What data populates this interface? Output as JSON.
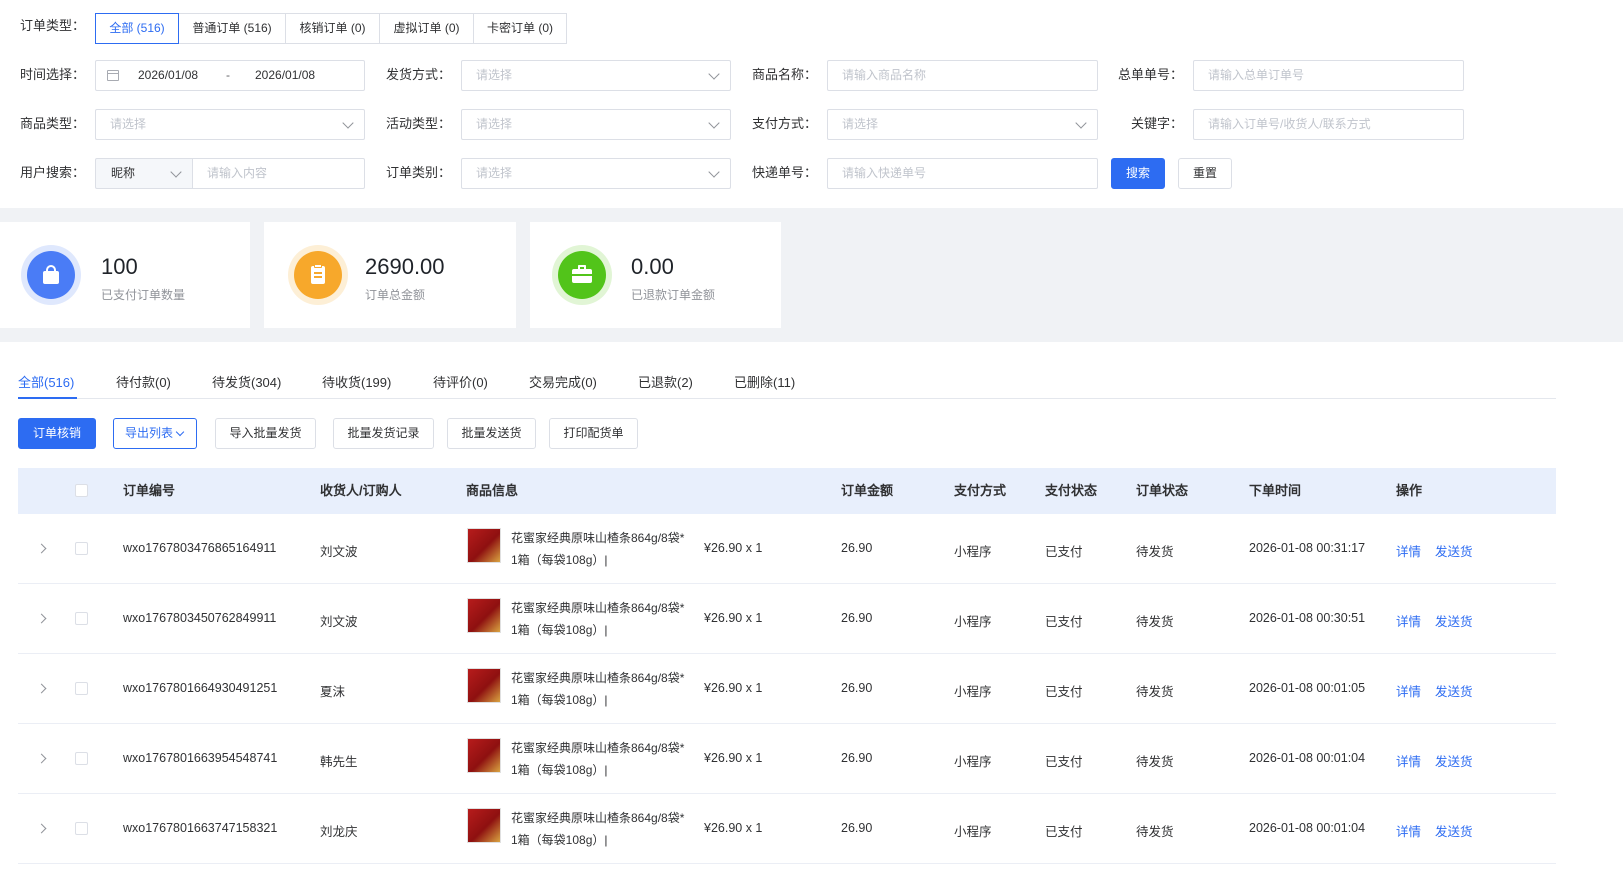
{
  "filters": {
    "order_type_label": "订单类型：",
    "order_types": [
      "全部 (516)",
      "普通订单 (516)",
      "核销订单 (0)",
      "虚拟订单 (0)",
      "卡密订单 (0)"
    ],
    "time_label": "时间选择：",
    "date_start": "2026/01/08",
    "date_sep": "-",
    "date_end": "2026/01/08",
    "ship_label": "发货方式：",
    "ship_placeholder": "请选择",
    "product_name_label": "商品名称：",
    "product_name_placeholder": "请输入商品名称",
    "main_order_label": "总单单号：",
    "main_order_placeholder": "请输入总单订单号",
    "product_type_label": "商品类型：",
    "product_type_placeholder": "请选择",
    "activity_label": "活动类型：",
    "activity_placeholder": "请选择",
    "pay_method_label": "支付方式：",
    "pay_method_placeholder": "请选择",
    "keyword_label": "关键字：",
    "keyword_placeholder": "请输入订单号/收货人/联系方式",
    "user_search_label": "用户搜索：",
    "user_field_value": "昵称",
    "user_content_placeholder": "请输入内容",
    "order_category_label": "订单类别：",
    "order_category_placeholder": "请选择",
    "express_label": "快递单号：",
    "express_placeholder": "请输入快递单号",
    "search_button": "搜索",
    "reset_button": "重置"
  },
  "stats": [
    {
      "value": "100",
      "label": "已支付订单数量",
      "color": "#4a7cf6",
      "ring": "#dfe8fd",
      "icon": "shopping-bag-icon"
    },
    {
      "value": "2690.00",
      "label": "订单总金额",
      "color": "#f7a82b",
      "ring": "#fdefd6",
      "icon": "clipboard-icon"
    },
    {
      "value": "0.00",
      "label": "已退款订单金额",
      "color": "#52c41a",
      "ring": "#e1f5d5",
      "icon": "briefcase-icon"
    }
  ],
  "status_tabs": [
    "全部(516)",
    "待付款(0)",
    "待发货(304)",
    "待收货(199)",
    "待评价(0)",
    "交易完成(0)",
    "已退款(2)",
    "已删除(11)"
  ],
  "actions": {
    "verify": "订单核销",
    "export": "导出列表",
    "import_ship": "导入批量发货",
    "ship_records": "批量发货记录",
    "batch_ship": "批量发送货",
    "print": "打印配货单"
  },
  "table": {
    "headers": {
      "order_no": "订单编号",
      "receiver": "收货人/订购人",
      "product": "商品信息",
      "amount": "订单金额",
      "pay_method": "支付方式",
      "pay_status": "支付状态",
      "order_status": "订单状态",
      "time": "下单时间",
      "ops": "操作"
    },
    "rows": [
      {
        "order_no": "wxo1767803476865164911",
        "receiver": "刘文波",
        "product_line1": "花蜜家经典原味山楂条864g/8袋*",
        "product_line2": "1箱（每袋108g）|",
        "price_qty": "¥26.90 x 1",
        "amount": "26.90",
        "pay_method": "小程序",
        "pay_status": "已支付",
        "order_status": "待发货",
        "time": "2026-01-08 00:31:17",
        "op_detail": "详情",
        "op_ship": "发送货"
      },
      {
        "order_no": "wxo1767803450762849911",
        "receiver": "刘文波",
        "product_line1": "花蜜家经典原味山楂条864g/8袋*",
        "product_line2": "1箱（每袋108g）|",
        "price_qty": "¥26.90 x 1",
        "amount": "26.90",
        "pay_method": "小程序",
        "pay_status": "已支付",
        "order_status": "待发货",
        "time": "2026-01-08 00:30:51",
        "op_detail": "详情",
        "op_ship": "发送货"
      },
      {
        "order_no": "wxo1767801664930491251",
        "receiver": "夏沫",
        "product_line1": "花蜜家经典原味山楂条864g/8袋*",
        "product_line2": "1箱（每袋108g）|",
        "price_qty": "¥26.90 x 1",
        "amount": "26.90",
        "pay_method": "小程序",
        "pay_status": "已支付",
        "order_status": "待发货",
        "time": "2026-01-08 00:01:05",
        "op_detail": "详情",
        "op_ship": "发送货"
      },
      {
        "order_no": "wxo1767801663954548741",
        "receiver": "韩先生",
        "product_line1": "花蜜家经典原味山楂条864g/8袋*",
        "product_line2": "1箱（每袋108g）|",
        "price_qty": "¥26.90 x 1",
        "amount": "26.90",
        "pay_method": "小程序",
        "pay_status": "已支付",
        "order_status": "待发货",
        "time": "2026-01-08 00:01:04",
        "op_detail": "详情",
        "op_ship": "发送货"
      },
      {
        "order_no": "wxo1767801663747158321",
        "receiver": "刘龙庆",
        "product_line1": "花蜜家经典原味山楂条864g/8袋*",
        "product_line2": "1箱（每袋108g）|",
        "price_qty": "¥26.90 x 1",
        "amount": "26.90",
        "pay_method": "小程序",
        "pay_status": "已支付",
        "order_status": "待发货",
        "time": "2026-01-08 00:01:04",
        "op_detail": "详情",
        "op_ship": "发送货"
      }
    ]
  }
}
